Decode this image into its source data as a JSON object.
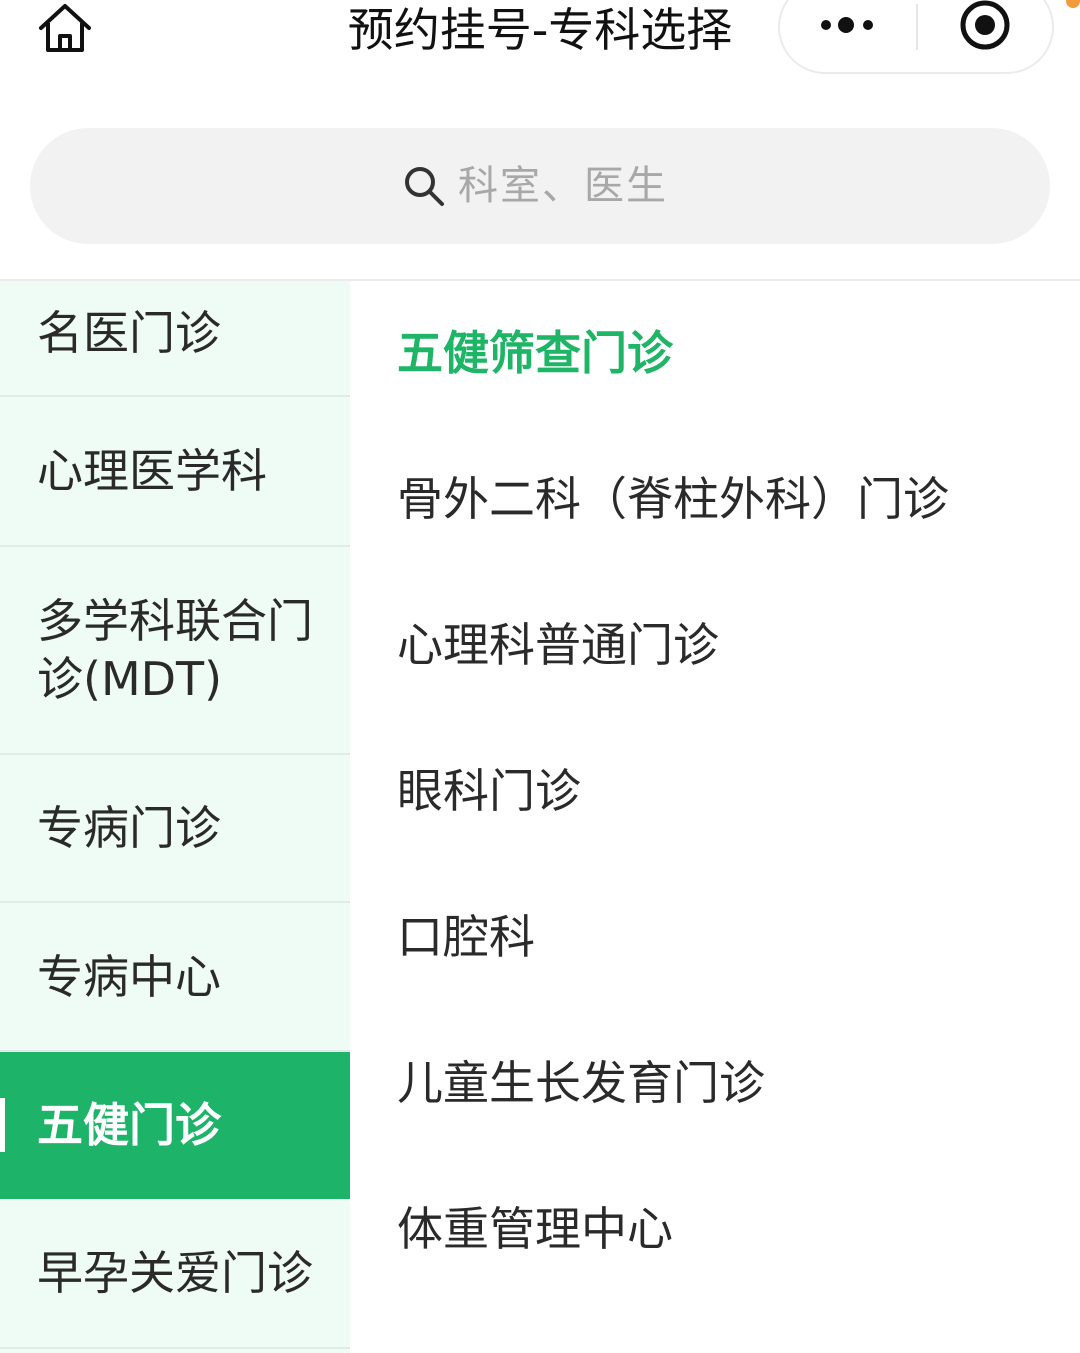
{
  "navbar": {
    "title": "预约挂号-专科选择",
    "home_icon": "home-icon",
    "more_icon": "more-dots-icon",
    "close_icon": "miniprogram-close-icon"
  },
  "search": {
    "placeholder": "科室、医生",
    "icon": "search-icon"
  },
  "categories": [
    {
      "label": "名医门诊"
    },
    {
      "label": "心理医学科"
    },
    {
      "label": "多学科联合门诊(MDT)"
    },
    {
      "label": "专病门诊"
    },
    {
      "label": "专病中心"
    },
    {
      "label": "五健门诊",
      "selected": true
    },
    {
      "label": "早孕关爱门诊"
    }
  ],
  "departments": [
    {
      "label": "五健筛查门诊",
      "highlighted": true
    },
    {
      "label": "骨外二科（脊柱外科）门诊"
    },
    {
      "label": "心理科普通门诊"
    },
    {
      "label": "眼科门诊"
    },
    {
      "label": "口腔科"
    },
    {
      "label": "儿童生长发育门诊"
    },
    {
      "label": "体重管理中心"
    }
  ],
  "colors": {
    "accent_green": "#1db46a",
    "highlight_text_green": "#1fb567",
    "left_nav_bg": "#effbf5",
    "search_bg": "#f2f2f2"
  }
}
